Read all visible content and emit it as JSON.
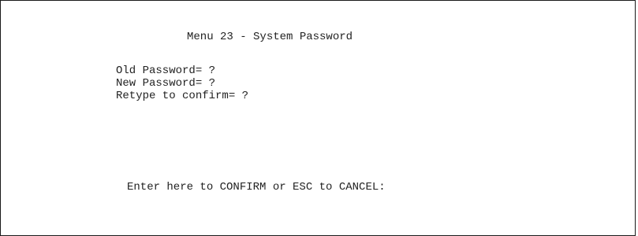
{
  "menu": {
    "title": "Menu 23 - System Password"
  },
  "fields": [
    {
      "label": "Old Password= ?"
    },
    {
      "label": "New Password= ?"
    },
    {
      "label": "Retype to confirm= ?"
    }
  ],
  "footer": {
    "prompt": "Enter here to CONFIRM or ESC to CANCEL:"
  }
}
